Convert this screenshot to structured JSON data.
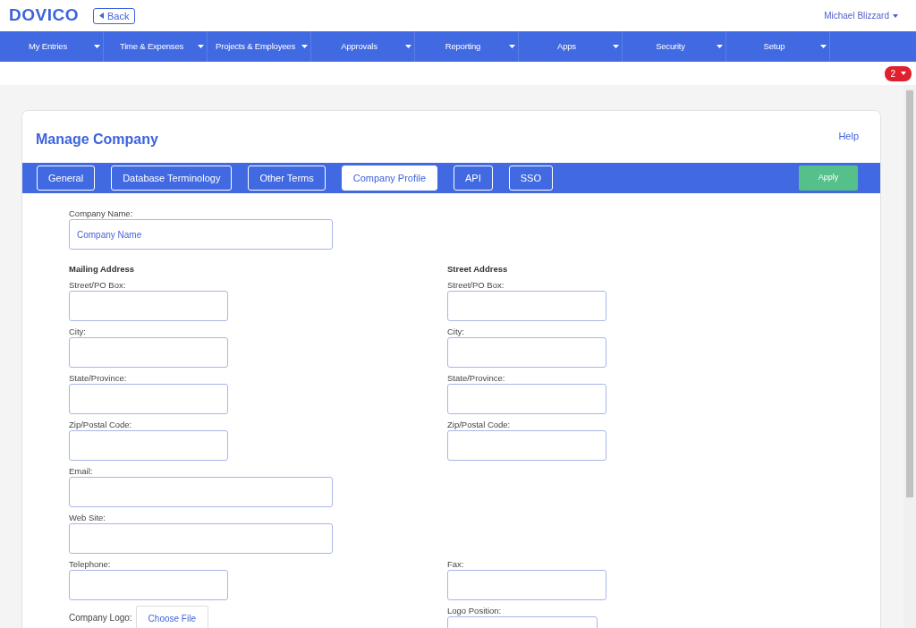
{
  "header": {
    "logo": "DOVICO",
    "back_button": "Back",
    "user_menu": "Michael Blizzard"
  },
  "nav": [
    {
      "label": "My Entries"
    },
    {
      "label": "Time & Expenses"
    },
    {
      "label": "Projects & Employees"
    },
    {
      "label": "Approvals"
    },
    {
      "label": "Reporting"
    },
    {
      "label": "Apps"
    },
    {
      "label": "Security"
    },
    {
      "label": "Setup"
    }
  ],
  "notification_badge": "2",
  "card": {
    "title": "Manage Company",
    "help_link": "Help",
    "tabs": [
      {
        "label": "General",
        "selected": false
      },
      {
        "label": "Database Terminology",
        "selected": false
      },
      {
        "label": "Other Terms",
        "selected": false
      },
      {
        "label": "Company Profile",
        "selected": true
      },
      {
        "label": "API",
        "selected": false
      },
      {
        "label": "SSO",
        "selected": false
      }
    ],
    "apply_button": "Apply",
    "company_name": {
      "label": "Company Name:",
      "placeholder": "Company Name"
    },
    "rows": [
      {
        "left": {
          "kind": "heading",
          "label": "Mailing Address"
        },
        "right": {
          "kind": "heading",
          "label": "Street Address"
        }
      },
      {
        "left": {
          "kind": "short",
          "label": "Street/PO Box:"
        },
        "right": {
          "kind": "short",
          "label": "Street/PO Box:"
        }
      },
      {
        "left": {
          "kind": "short",
          "label": "City:"
        },
        "right": {
          "kind": "short",
          "label": "City:"
        }
      },
      {
        "left": {
          "kind": "short",
          "label": "State/Province:"
        },
        "right": {
          "kind": "short",
          "label": "State/Province:"
        }
      },
      {
        "left": {
          "kind": "short",
          "label": "Zip/Postal Code:"
        },
        "right": {
          "kind": "short",
          "label": "Zip/Postal Code:"
        }
      },
      {
        "left": {
          "kind": "wide",
          "label": "Email:"
        }
      },
      {
        "left": {
          "kind": "wide",
          "label": "Web Site:"
        }
      },
      {
        "left": {
          "kind": "short",
          "label": "Telephone:"
        },
        "right": {
          "kind": "short",
          "label": "Fax:"
        }
      },
      {
        "left": {
          "kind": "file",
          "label": "Company Logo:",
          "button": "Choose File"
        },
        "right": {
          "kind": "select",
          "label": "Logo Position:"
        }
      }
    ]
  }
}
